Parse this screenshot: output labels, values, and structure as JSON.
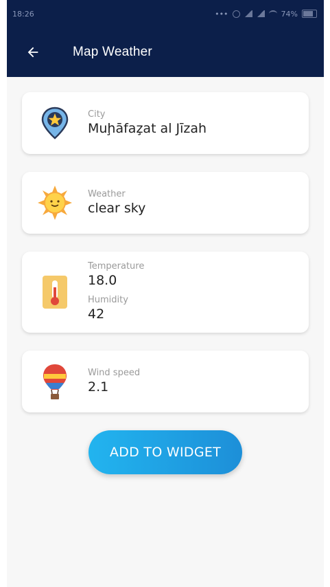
{
  "status": {
    "time": "18:26",
    "battery": "74%"
  },
  "appbar": {
    "title": "Map Weather"
  },
  "cards": {
    "city": {
      "label": "City",
      "value": "Muḩāfaz̧at al Jīzah",
      "icon": "map-pin-star-icon"
    },
    "weather": {
      "label": "Weather",
      "value": "clear sky",
      "icon": "sun-icon"
    },
    "temperature": {
      "label": "Temperature",
      "value": "18.0",
      "icon": "thermometer-icon"
    },
    "humidity": {
      "label": "Humidity",
      "value": "42"
    },
    "wind": {
      "label": "Wind speed",
      "value": "2.1",
      "icon": "hot-air-balloon-icon"
    }
  },
  "actions": {
    "add_widget_label": "ADD TO WIDGET"
  },
  "colors": {
    "appbar": "#0c1f4a",
    "button_start": "#22b4ef",
    "button_end": "#1d8fd8",
    "background": "#f7f7f7"
  }
}
